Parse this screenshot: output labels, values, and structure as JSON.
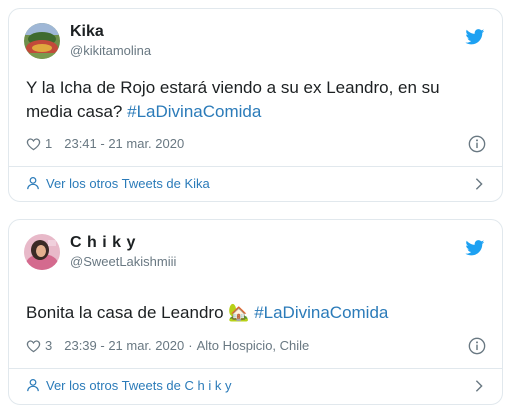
{
  "tweets": [
    {
      "name": "Kika",
      "handle": "@kikitamolina",
      "text_parts": [
        "Y la Icha de Rojo estará viendo a su ex Leandro, en su media casa?"
      ],
      "hashtag": "#LaDivinaComida",
      "likes": "1",
      "time": "23:41 - 21 mar. 2020",
      "location": "",
      "footer": "Ver los otros Tweets de Kika"
    },
    {
      "name": "C h i k y",
      "handle": "@SweetLakishmiii",
      "text_parts": [
        "Bonita la casa de Leandro"
      ],
      "emoji": "🏡",
      "hashtag": "#LaDivinaComida",
      "likes": "3",
      "time": "23:39 - 21 mar. 2020",
      "location": "Alto Hospicio, Chile",
      "location_sep": "·",
      "footer": "Ver los otros Tweets de C h i k y"
    }
  ],
  "colors": {
    "link": "#2b7bb9",
    "muted": "#697882",
    "border": "#e1e8ed",
    "twitter_blue": "#1da1f2"
  },
  "icons": [
    "twitter-bird-icon",
    "heart-icon",
    "info-icon",
    "user-icon",
    "chevron-right-icon"
  ]
}
